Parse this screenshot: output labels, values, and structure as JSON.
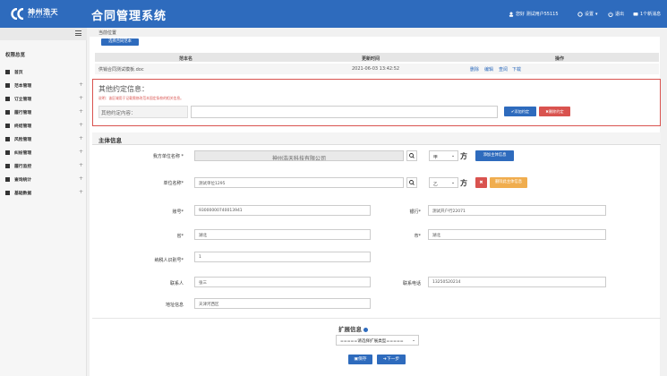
{
  "brand": {
    "logo_cn": "神州浩天",
    "logo_en": "GREAT-CHN",
    "app_title": "合同管理系统"
  },
  "topbar": {
    "user": "您好 测试用户55115",
    "settings": "设置",
    "logout": "退出",
    "messages": "1个新消息"
  },
  "sidebar": {
    "title": "权限总览",
    "items": [
      {
        "label": "首页",
        "plus": ""
      },
      {
        "label": "范本管理",
        "plus": "+"
      },
      {
        "label": "订立管理",
        "plus": "+"
      },
      {
        "label": "履行管理",
        "plus": "+"
      },
      {
        "label": "终结管理",
        "plus": "+"
      },
      {
        "label": "风险管理",
        "plus": "+"
      },
      {
        "label": "纠纷管理",
        "plus": "+"
      },
      {
        "label": "履行监控",
        "plus": "+"
      },
      {
        "label": "查询统计",
        "plus": "+"
      },
      {
        "label": "基础数据",
        "plus": "+"
      }
    ]
  },
  "breadcrumb": "当前位置",
  "choose_template": "选择合同范本",
  "table": {
    "headers": {
      "name": "范本名",
      "updated": "更新时间",
      "ops": "操作"
    },
    "row": {
      "name": "供销合同测试模板.doc",
      "updated": "2021-06-03 13:42:52",
      "del": "删除",
      "edit": "编辑",
      "view": "查阅",
      "download": "下载"
    }
  },
  "other": {
    "title": "其他约定信息：",
    "note": "说明：该区域用于记载需修改范本固定条款的相关信息。",
    "label": "其他约定内容：",
    "input": "",
    "add_btn": "✔添加约定",
    "del_btn": "✖删除约定"
  },
  "subject": {
    "title": "主体信息",
    "our_label": "我方单位名称 *",
    "our_value": "神州浩天科技有限公司",
    "party_a": "甲",
    "fang": "方",
    "add_subject": "添加主体信息",
    "unit_label": "单位名称*",
    "unit_value": "测试单位1295",
    "party_b": "乙",
    "del_subject_btn": "✖",
    "delete_subject": "删除此主体信息",
    "account_label": "账号*",
    "account_value": "93000000740013941",
    "bank_label": "银行*",
    "bank_value": "测试开户行22071",
    "province_label": "省*",
    "province_value": "湖北",
    "city_label": "市*",
    "city_value": "湖北",
    "taxid_label": "纳税人识别号*",
    "taxid_value": "1",
    "contact_label": "联系人",
    "contact_value": "张三",
    "phone_label": "联系电话",
    "phone_value": "13250520214",
    "address_label": "地址信息",
    "address_value": "天津河西区"
  },
  "extend": {
    "title": "扩展信息",
    "select": "=====请选择扩展类型=====",
    "save": "保存",
    "next": "下一步"
  },
  "colors": {
    "primary": "#2e6bbd",
    "danger": "#d9534f",
    "warning": "#f0ad4e"
  }
}
